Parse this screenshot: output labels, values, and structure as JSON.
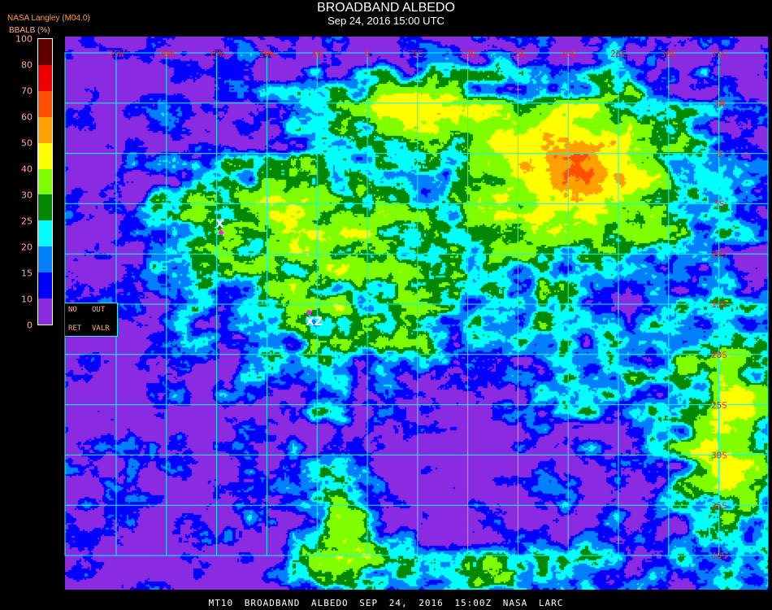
{
  "header": {
    "title": "BROADBAND ALBEDO",
    "subtitle": "Sep 24, 2016 15:00 UTC",
    "source": "NASA Langley (M04.0)"
  },
  "colorbar": {
    "label": "BBALB (%)",
    "ticks": [
      "100",
      "80",
      "70",
      "60",
      "50",
      "40",
      "30",
      "25",
      "20",
      "15",
      "10",
      "0"
    ],
    "colors": [
      "#600000",
      "#f00000",
      "#ff5000",
      "#ffa000",
      "#ffff00",
      "#80ff00",
      "#008800",
      "#00ffff",
      "#0080ff",
      "#0000ff",
      "#8a2be2"
    ]
  },
  "grid": {
    "lon_labels": [
      "25W",
      "20W",
      "15W",
      "10W",
      "5W",
      "0",
      "5E",
      "10E",
      "15E",
      "20E",
      "25E",
      "30E",
      "35E"
    ],
    "lat_labels": [
      "5N",
      "0",
      "5S",
      "10S",
      "15S",
      "20S",
      "25S",
      "30S",
      "35S",
      "40S"
    ],
    "line_color": "#00ffff",
    "label_color": "#ff2020"
  },
  "legend_box": {
    "no": "NO",
    "out": "OUT",
    "ret": "RET",
    "valr": "VALR"
  },
  "markers": [
    {
      "label": "X"
    },
    {
      "label": "XZ"
    }
  ],
  "footer": "MT10  BROADBAND ALBEDO   SEP 24, 2016 15:00Z   NASA LARC"
}
